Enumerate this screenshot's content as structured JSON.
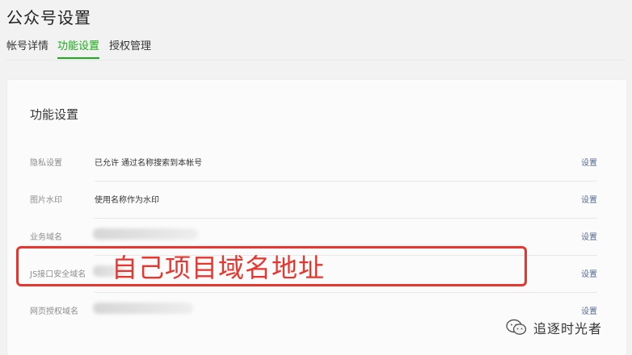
{
  "header": {
    "title": "公众号设置"
  },
  "tabs": [
    {
      "label": "帐号详情",
      "active": false
    },
    {
      "label": "功能设置",
      "active": true
    },
    {
      "label": "授权管理",
      "active": false
    }
  ],
  "section": {
    "title": "功能设置",
    "rows": [
      {
        "label": "隐私设置",
        "value": "已允许 通过名称搜索到本帐号",
        "action": "设置"
      },
      {
        "label": "图片水印",
        "value": "使用名称作为水印",
        "action": "设置"
      },
      {
        "label": "业务域名",
        "value": "",
        "action": "设置"
      },
      {
        "label": "JS接口安全域名",
        "value": "",
        "action": "设置"
      },
      {
        "label": "网页授权域名",
        "value": "",
        "action": "设置"
      }
    ]
  },
  "annotation": {
    "text": "自己项目域名地址",
    "color": "#e8362f"
  },
  "watermark": {
    "text": "追逐时光者",
    "icon": "wechat-icon"
  },
  "colors": {
    "accent": "#1aad19",
    "link": "#576b95"
  }
}
